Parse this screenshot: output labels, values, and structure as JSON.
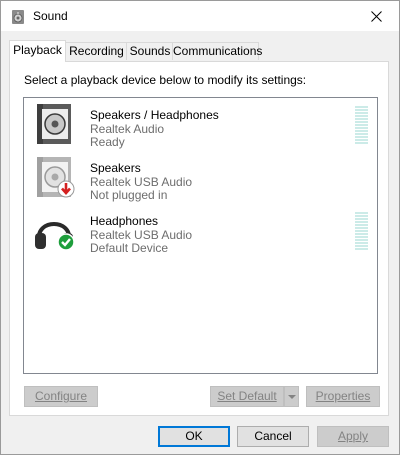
{
  "window": {
    "title": "Sound"
  },
  "tabs": [
    {
      "label": "Playback",
      "active": true
    },
    {
      "label": "Recording",
      "active": false
    },
    {
      "label": "Sounds",
      "active": false
    },
    {
      "label": "Communications",
      "active": false
    }
  ],
  "playback": {
    "instruction": "Select a playback device below to modify its settings:",
    "devices": [
      {
        "name": "Speakers / Headphones",
        "driver": "Realtek Audio",
        "status": "Ready",
        "icon": "speaker-icon",
        "level": 0
      },
      {
        "name": "Speakers",
        "driver": "Realtek USB Audio",
        "status": "Not plugged in",
        "icon": "speaker-unplugged-icon",
        "badge": "red-down-arrow"
      },
      {
        "name": "Headphones",
        "driver": "Realtek USB Audio",
        "status": "Default Device",
        "icon": "headphones-icon",
        "badge": "green-check",
        "level": 0
      }
    ],
    "buttons": {
      "configure": "Configure",
      "set_default": "Set Default",
      "properties": "Properties"
    }
  },
  "footer": {
    "ok": "OK",
    "cancel": "Cancel",
    "apply": "Apply"
  },
  "colors": {
    "accent": "#0078d7",
    "check_badge": "#1e9e3c",
    "unplugged_badge": "#d42020",
    "meter": "#ccebe8"
  }
}
